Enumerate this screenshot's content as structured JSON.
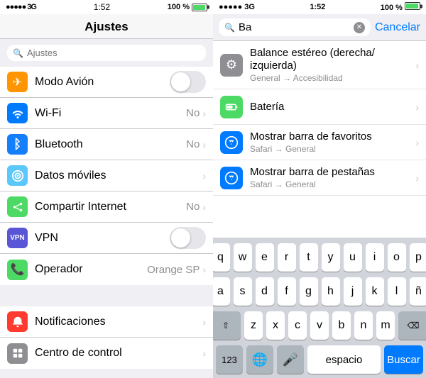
{
  "left": {
    "statusBar": {
      "signal": "●●●●● 3G",
      "time": "1:52",
      "batteryPercent": "100 %"
    },
    "title": "Ajustes",
    "searchPlaceholder": "Ajustes",
    "items": [
      {
        "id": "modo-avion",
        "label": "Modo Avión",
        "iconColor": "icon-orange",
        "iconChar": "✈",
        "control": "toggle",
        "toggleOn": false
      },
      {
        "id": "wifi",
        "label": "Wi-Fi",
        "iconColor": "icon-blue",
        "iconChar": "📶",
        "value": "No",
        "chevron": true
      },
      {
        "id": "bluetooth",
        "label": "Bluetooth",
        "iconColor": "icon-blue2",
        "iconChar": "🅱",
        "value": "No",
        "chevron": true
      },
      {
        "id": "datos",
        "label": "Datos móviles",
        "iconColor": "icon-green2",
        "iconChar": "📡",
        "chevron": true
      },
      {
        "id": "compartir",
        "label": "Compartir Internet",
        "iconColor": "icon-green",
        "iconChar": "🔗",
        "value": "No",
        "chevron": true
      },
      {
        "id": "vpn",
        "label": "VPN",
        "iconColor": "icon-vpn",
        "iconText": "VPN",
        "control": "toggle",
        "toggleOn": false
      },
      {
        "id": "operador",
        "label": "Operador",
        "iconColor": "icon-operator",
        "iconChar": "📞",
        "value": "Orange SP",
        "chevron": true
      }
    ],
    "items2": [
      {
        "id": "notificaciones",
        "label": "Notificaciones",
        "iconColor": "icon-red",
        "iconChar": "🔔",
        "chevron": true
      },
      {
        "id": "centro-control",
        "label": "Centro de control",
        "iconColor": "icon-gray",
        "iconChar": "⊞",
        "chevron": true
      }
    ]
  },
  "right": {
    "statusBar": {
      "signal": "●●●●● 3G",
      "time": "1:52",
      "batteryPercent": "100 %"
    },
    "searchValue": "Ba",
    "cancelLabel": "Cancelar",
    "results": [
      {
        "id": "balance",
        "iconColor": "ri-gray",
        "iconChar": "⚙",
        "title": "Balance estéreo (derecha/ izquierda)",
        "subtitle": "General → Accesibilidad",
        "chevron": true
      },
      {
        "id": "bateria",
        "iconColor": "ri-green",
        "iconChar": "🔋",
        "title": "Batería",
        "subtitle": "",
        "chevron": true
      },
      {
        "id": "mostrar-barra-favoritos",
        "iconColor": "ri-blue",
        "iconChar": "◎",
        "title": "Mostrar barra de favoritos",
        "subtitle": "Safari → General",
        "chevron": true
      },
      {
        "id": "mostrar-barra-pestanas",
        "iconColor": "ri-blue",
        "iconChar": "◎",
        "title": "Mostrar barra de pestañas",
        "subtitle": "Safari → General",
        "chevron": true
      }
    ],
    "keyboard": {
      "row1": [
        "q",
        "w",
        "e",
        "r",
        "t",
        "y",
        "u",
        "i",
        "o",
        "p"
      ],
      "row2": [
        "a",
        "s",
        "d",
        "f",
        "g",
        "h",
        "j",
        "k",
        "l",
        "ñ"
      ],
      "row3": [
        "z",
        "x",
        "c",
        "v",
        "b",
        "n",
        "m"
      ],
      "num123": "123",
      "globe": "🌐",
      "mic": "🎤",
      "space": "espacio",
      "searchBtn": "Buscar",
      "backspace": "⌫",
      "shift": "⇧"
    }
  }
}
